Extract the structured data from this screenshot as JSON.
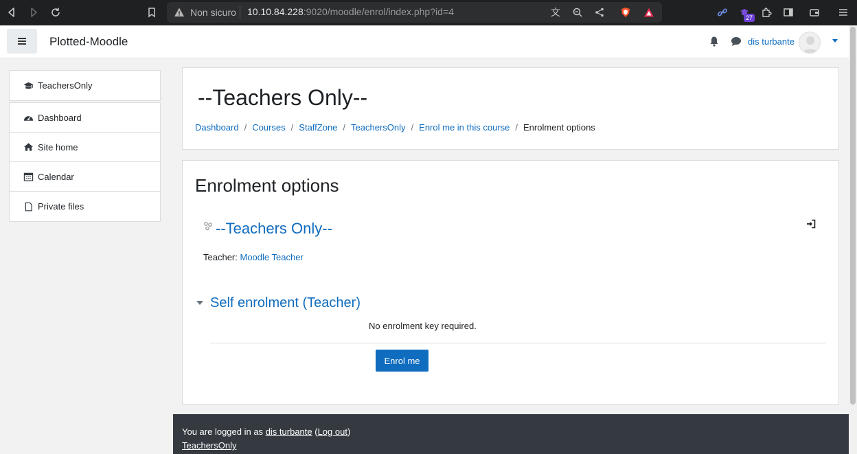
{
  "browser": {
    "security_label": "Non sicuro",
    "url_host": "10.10.84.228",
    "url_rest": ":9020/moodle/enrol/index.php?id=4",
    "extension_badge": "27"
  },
  "navbar": {
    "site_name": "Plotted-Moodle",
    "user_name": "dis turbante"
  },
  "drawer": {
    "course_item": "TeachersOnly",
    "items": [
      {
        "label": "Dashboard",
        "icon": "dashboard-icon"
      },
      {
        "label": "Site home",
        "icon": "home-icon"
      },
      {
        "label": "Calendar",
        "icon": "calendar-icon"
      },
      {
        "label": "Private files",
        "icon": "file-icon"
      }
    ]
  },
  "header": {
    "title": "--Teachers Only--",
    "breadcrumbs": [
      "Dashboard",
      "Courses",
      "StaffZone",
      "TeachersOnly",
      "Enrol me in this course",
      "Enrolment options"
    ],
    "separator": "/"
  },
  "content": {
    "heading": "Enrolment options",
    "course_name": "--Teachers Only--",
    "teacher_label": "Teacher:",
    "teacher_name": "Moodle Teacher",
    "section_title": "Self enrolment (Teacher)",
    "no_key_text": "No enrolment key required.",
    "enrol_button": "Enrol me"
  },
  "footer": {
    "logged_in_prefix": "You are logged in as",
    "user_name": "dis turbante",
    "logout_label": "Log out",
    "course_link": "TeachersOnly"
  },
  "colors": {
    "link": "#0f6cbf",
    "footer_bg": "#343a40",
    "page_bg": "#f2f2f2"
  }
}
